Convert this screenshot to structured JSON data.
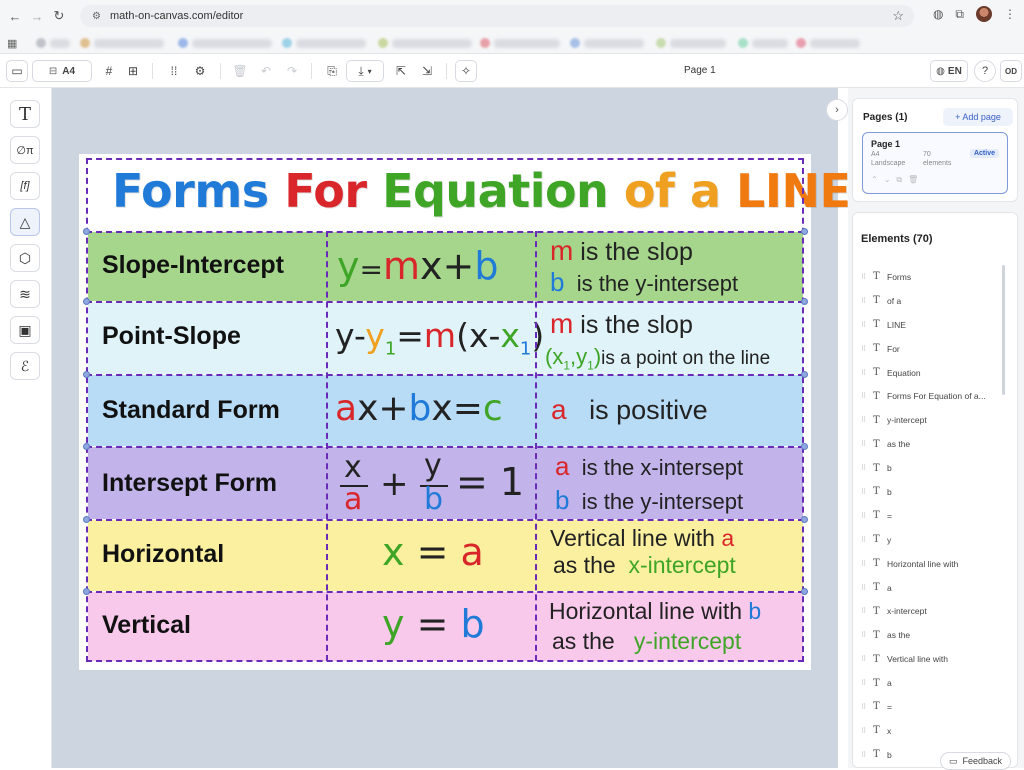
{
  "browser": {
    "url": "math-on-canvas.com/editor"
  },
  "toolbar": {
    "page_size": "A4",
    "page_label": "Page 1",
    "language": "EN",
    "help": "?",
    "user_initials": "OD"
  },
  "poster": {
    "title_words": [
      {
        "text": "Forms",
        "color": "#1f7ad8"
      },
      {
        "text": "For",
        "color": "#d9262a"
      },
      {
        "text": "Equation",
        "color": "#3fa526"
      },
      {
        "text": "of",
        "color": "#f0a020"
      },
      {
        "text": "a",
        "color": "#f0a020"
      },
      {
        "text": "LINE",
        "color": "#f07a10"
      }
    ],
    "rows": [
      {
        "name": "Slope-Intercept",
        "bg": "#a5d68c"
      },
      {
        "name": "Point-Slope",
        "bg": "#dff3f9"
      },
      {
        "name": "Standard Form",
        "bg": "#b8dcf6"
      },
      {
        "name": "Intersept Form",
        "bg": "#c2b3ea"
      },
      {
        "name": "Horizontal",
        "bg": "#fbf0a0"
      },
      {
        "name": "Vertical",
        "bg": "#f9c9ec"
      }
    ],
    "eq1": {
      "y": "y",
      "eqsign": "=",
      "m": "m",
      "x": "x",
      "plus": "+",
      "b": "b"
    },
    "eq2": {
      "y": "y-",
      "y1": "y",
      "y1sub": "1",
      "eqsign": "=",
      "m": "m",
      "paren": "(x-",
      "x1": "x",
      "x1sub": "1",
      "close": ")"
    },
    "eq3": {
      "a": "a",
      "x1": "x+",
      "b": "b",
      "x2": "x=",
      "c": "c"
    },
    "eq4": {
      "xnum": "x",
      "aden": "a",
      "plus": "+",
      "ynum": "y",
      "bden": "b",
      "rest": "= 1"
    },
    "eq5": {
      "x": "x",
      "eqsign": "=",
      "a": "a"
    },
    "eq6": {
      "y": "y",
      "eqsign": "=",
      "b": "b"
    },
    "desc1": {
      "m": "m",
      "t1": "is the slop",
      "b": "b",
      "t2": "is the y-intersept"
    },
    "desc2": {
      "m": "m",
      "t1": "is the slop",
      "open": "(x",
      "s1": "1",
      "y": ",y",
      "s2": "1",
      "close": ")",
      "t2": "is a point on the line"
    },
    "desc3": {
      "a": "a",
      "t1": "is positive"
    },
    "desc4": {
      "a": "a",
      "t1": "is the x-intersept",
      "b": "b",
      "t2": "is the y-intersept"
    },
    "desc5": {
      "t1": "Vertical line with",
      "a": "a",
      "t2": "as the",
      "t3": "x-intercept"
    },
    "desc6": {
      "t1": "Horizontal line with",
      "b": "b",
      "t2": "as the",
      "t3": "y-intercept"
    }
  },
  "pages_panel": {
    "heading": "Pages (1)",
    "add_label": "+ Add page",
    "page": {
      "title": "Page 1",
      "size": "A4",
      "orientation": "Landscape",
      "count": "70",
      "count_label": "elements",
      "status": "Active"
    }
  },
  "elements_panel": {
    "heading": "Elements (70)",
    "items": [
      "Forms",
      "of a",
      "LINE",
      "For",
      "Equation",
      "Forms For Equation of a...",
      "y-intercept",
      "as the",
      "b",
      "b",
      "=",
      "y",
      "Horizontal line with",
      "a",
      "x-intercept",
      "as the",
      "Vertical line with",
      "a",
      "=",
      "x",
      "b"
    ]
  },
  "feedback_label": "Feedback",
  "colors": {
    "accent": "#3a62c6",
    "frame": "#6a2ab8",
    "canvas_bg": "#cdd5e0"
  },
  "icons": {
    "left_tools": [
      "text-icon",
      "math-icon",
      "function-icon",
      "shapes-icon",
      "cube-icon",
      "layers-icon",
      "image-icon",
      "draw-icon"
    ]
  }
}
